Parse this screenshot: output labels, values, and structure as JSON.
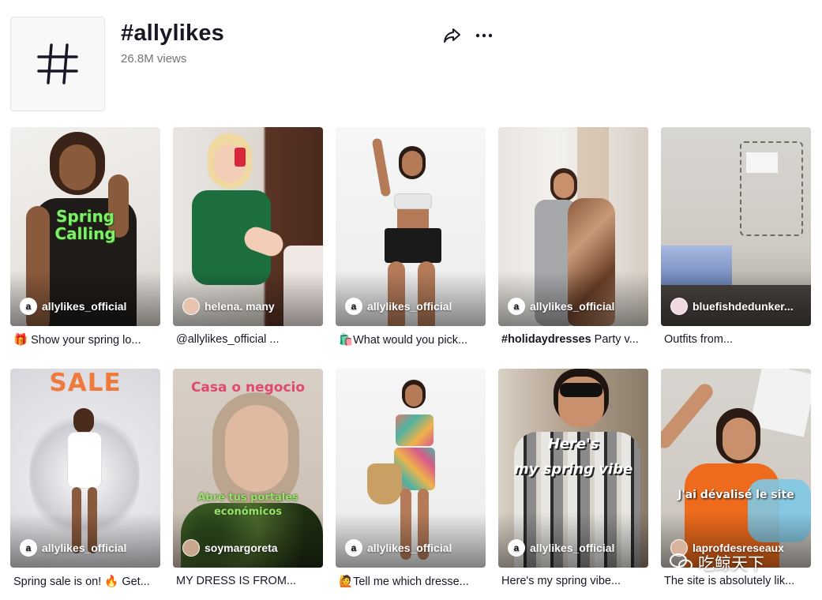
{
  "header": {
    "title": "#allylikes",
    "views": "26.8M views",
    "avatar_symbol": "#",
    "share_icon": "share-arrow-icon",
    "more_icon": "ellipsis-icon"
  },
  "videos": [
    {
      "author": "allylikes_official",
      "caption_prefix": "🎁 ",
      "caption": "Show your spring lo...",
      "overlay": "Spring\nCalling",
      "avatar_letter": "a"
    },
    {
      "author": "helena. many",
      "caption_prefix": "",
      "caption": "@allylikes_official ...",
      "overlay": "",
      "avatar_letter": ""
    },
    {
      "author": "allylikes_official",
      "caption_prefix": "🛍️",
      "caption": "What would you pick...",
      "overlay": "",
      "avatar_letter": "a"
    },
    {
      "author": "allylikes_official",
      "caption_bold": "#holidaydresses",
      "caption": " Party v...",
      "overlay": "",
      "avatar_letter": "a"
    },
    {
      "author": "bluefishdedunker...",
      "caption_prefix": "",
      "caption": "Outfits from...",
      "overlay": "",
      "avatar_letter": ""
    },
    {
      "author": "allylikes_official",
      "caption_prefix": "",
      "caption": "Spring sale is on! 🔥 Get...",
      "overlay": "SALE",
      "avatar_letter": "a"
    },
    {
      "author": "soymargoreta",
      "caption_prefix": "",
      "caption": "MY DRESS IS FROM...",
      "overlay": "Casa o negocio",
      "overlay2": "Abre tus portales\neconómicos",
      "avatar_letter": ""
    },
    {
      "author": "allylikes_official",
      "caption_prefix": "🙋",
      "caption": "Tell me which dresse...",
      "overlay": "",
      "avatar_letter": "a"
    },
    {
      "author": "allylikes_official",
      "caption_prefix": "",
      "caption": "Here's my spring vibe...",
      "overlay": "Here's\nmy spring vibe",
      "avatar_letter": "a"
    },
    {
      "author": "laprofdesreseaux",
      "caption_prefix": "",
      "caption": "The site is absolutely lik...",
      "overlay": "J'ai dévalisé le site",
      "avatar_letter": ""
    }
  ],
  "watermark": "吃鲸天下",
  "colors": {
    "text": "#161823",
    "muted": "#73747b",
    "spring_green": "#7ef06a",
    "sale_orange": "#f07a3c",
    "casa_pink": "#e0496b"
  }
}
